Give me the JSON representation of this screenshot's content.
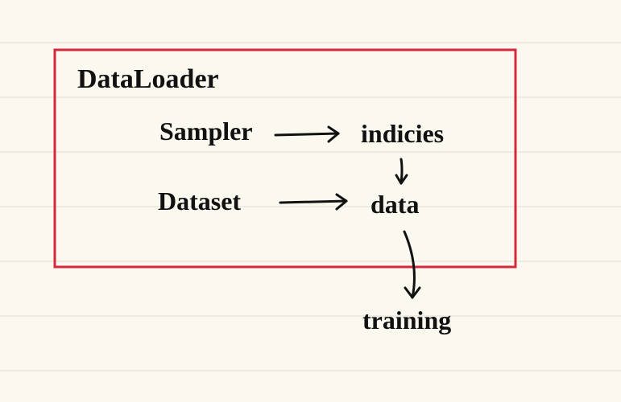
{
  "diagram": {
    "container_label": "DataLoader",
    "nodes": {
      "sampler": "Sampler",
      "indices": "indicies",
      "dataset": "Dataset",
      "data": "data",
      "training": "training"
    },
    "edges": [
      {
        "from": "sampler",
        "to": "indices"
      },
      {
        "from": "dataset",
        "to": "data"
      },
      {
        "from": "indices",
        "to": "data"
      },
      {
        "from": "data",
        "to": "training"
      }
    ],
    "colors": {
      "paper": "#fbf9ef",
      "rule": "#eeece2",
      "ink": "#111111",
      "box": "#d6283d"
    }
  }
}
